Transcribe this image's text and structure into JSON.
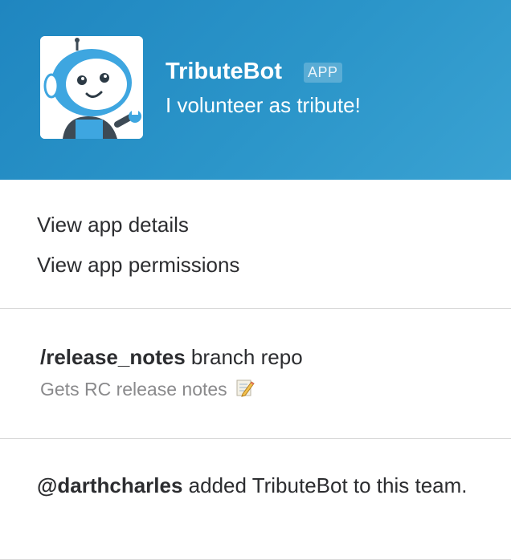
{
  "header": {
    "bot_name": "TributeBot",
    "badge": "APP",
    "tagline": "I volunteer as tribute!",
    "avatar_icon": "robot-avatar-icon",
    "gradient_start": "#1f86c0",
    "gradient_end": "#3aa2d2"
  },
  "menu": {
    "items": [
      {
        "label": "View app details"
      },
      {
        "label": "View app permissions"
      }
    ]
  },
  "command": {
    "name": "/release_notes",
    "args": " branch repo",
    "description": "Gets RC release notes",
    "description_icon": "pencil-memo-icon"
  },
  "footer": {
    "user": "@darthcharles",
    "message": " added TributeBot to this team."
  }
}
